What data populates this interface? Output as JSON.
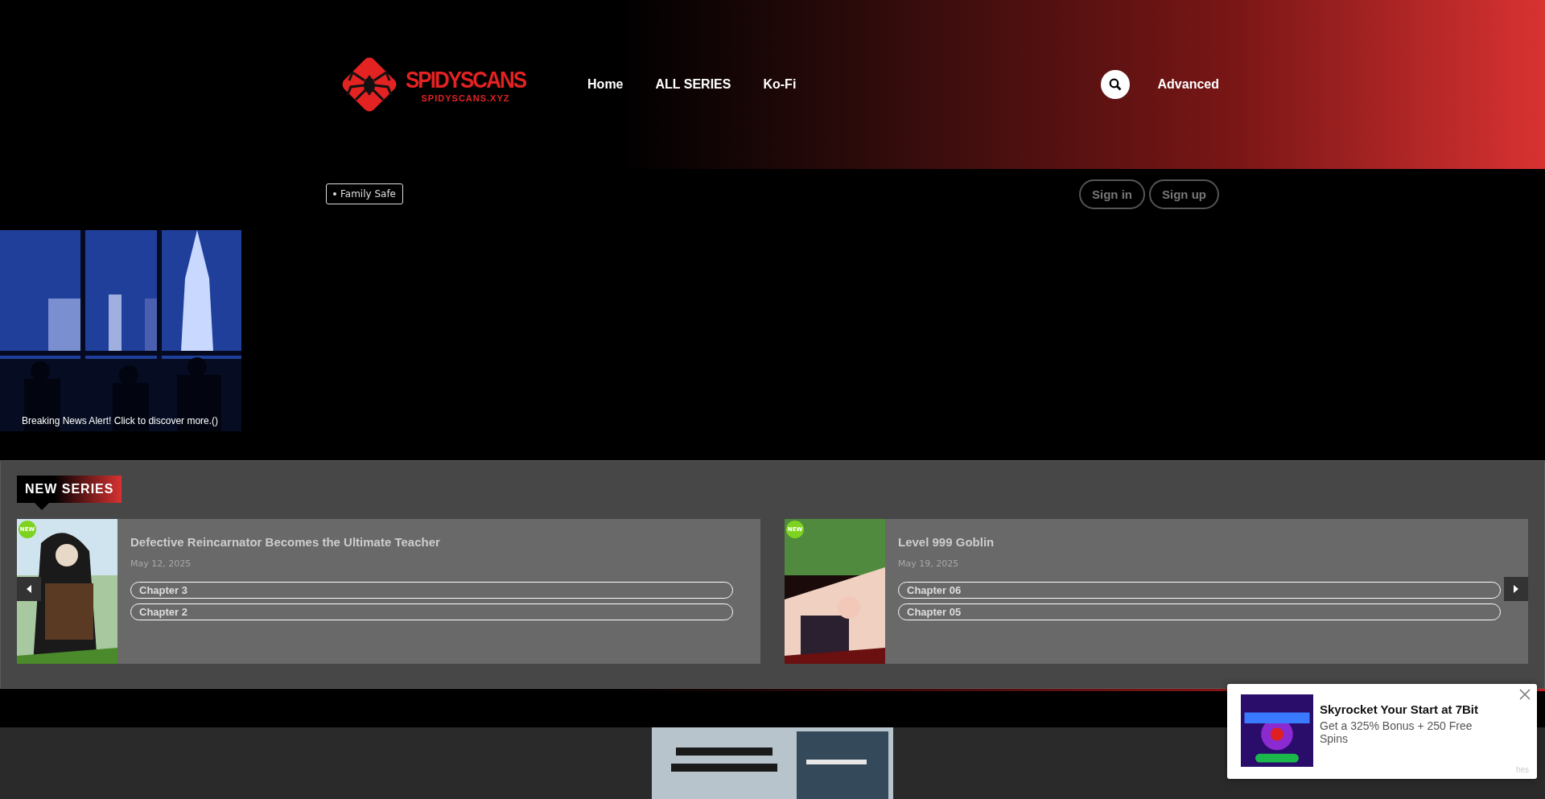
{
  "header": {
    "logo": {
      "name": "SPIDYSCANS",
      "domain": "SPIDYSCANS.XYZ"
    },
    "nav": [
      "Home",
      "ALL SERIES",
      "Ko-Fi"
    ],
    "advanced": "Advanced"
  },
  "subbar": {
    "badge": "Family Safe",
    "auth": [
      "Sign in",
      "Sign up"
    ]
  },
  "news_ad": {
    "caption": "Breaking News Alert! Click to discover more.()"
  },
  "new_series": {
    "heading": "NEW SERIES",
    "items": [
      {
        "title": "Defective Reincarnator Becomes the Ultimate Teacher",
        "date": "May 12, 2025",
        "badge": "NEW",
        "chapters": [
          "Chapter 3",
          "Chapter 2"
        ]
      },
      {
        "title": "Level 999 Goblin",
        "date": "May 19, 2025",
        "badge": "NEW",
        "chapters": [
          "Chapter 06",
          "Chapter 05"
        ]
      }
    ]
  },
  "popup": {
    "title": "Skyrocket Your Start at 7Bit",
    "body": "Get a 325% Bonus + 250 Free Spins",
    "tag": "hes"
  }
}
